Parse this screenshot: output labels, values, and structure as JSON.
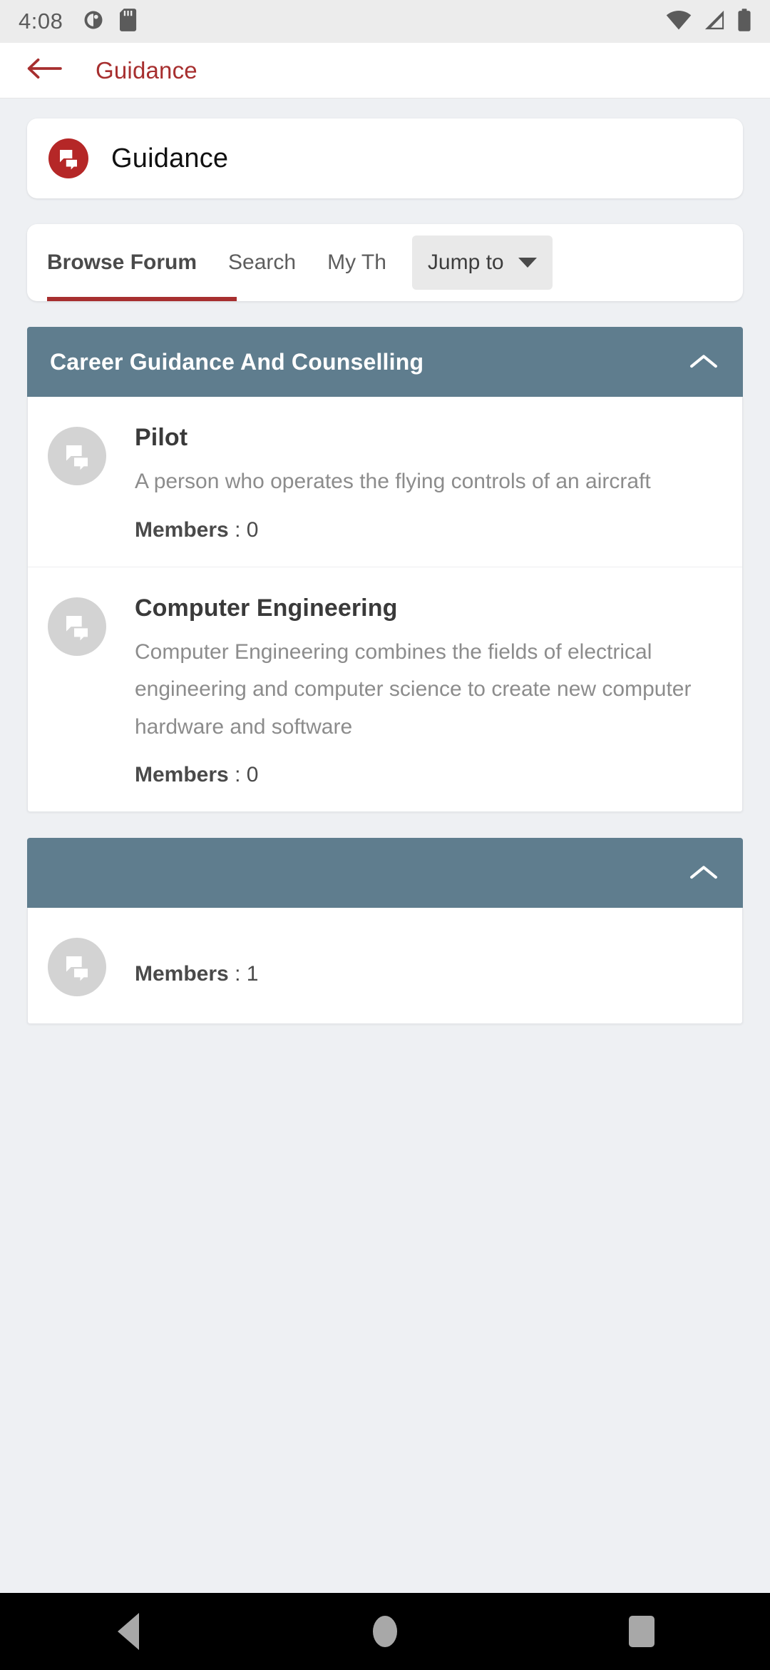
{
  "status_bar": {
    "time": "4:08",
    "left_icons": [
      "clock-badge-icon",
      "sd-card-icon"
    ],
    "right_icons": [
      "wifi-icon",
      "cellular-signal-icon",
      "battery-icon"
    ]
  },
  "app_bar": {
    "back_icon": "arrow-left-icon",
    "title": "Guidance",
    "title_color": "#a72f2f"
  },
  "forum_card": {
    "icon": "forum-icon",
    "icon_bg": "#b52727",
    "title": "Guidance"
  },
  "tabs": {
    "items": [
      {
        "label": "Browse Forum",
        "active": true
      },
      {
        "label": "Search",
        "active": false
      },
      {
        "label": "My Th",
        "active": false
      }
    ],
    "jump": {
      "label": "Jump to",
      "caret_icon": "chevron-down-icon"
    },
    "indicator_color": "#a72f2f"
  },
  "groups": [
    {
      "title": "Career Guidance And Counselling",
      "header_color": "#5f7d8e",
      "collapse_icon": "chevron-up-icon",
      "expanded": true,
      "rows": [
        {
          "avatar_icon": "forum-icon",
          "title": "Pilot",
          "description": "A person who operates the flying controls of an aircraft",
          "members_label": "Members",
          "members_value": ": 0"
        },
        {
          "avatar_icon": "forum-icon",
          "title": "Computer Engineering",
          "description": "Computer Engineering combines the fields of electrical engineering and computer science to create new computer hardware and software",
          "members_label": "Members",
          "members_value": ": 0"
        }
      ]
    },
    {
      "title": "",
      "header_color": "#5f7d8e",
      "collapse_icon": "chevron-up-icon",
      "expanded": true,
      "rows": [
        {
          "avatar_icon": "forum-icon",
          "title": "",
          "description": "",
          "members_label": "Members",
          "members_value": ": 1"
        }
      ]
    }
  ],
  "nav_bar": {
    "back": "nav-back-icon",
    "home": "nav-home-icon",
    "recents": "nav-recents-icon"
  }
}
